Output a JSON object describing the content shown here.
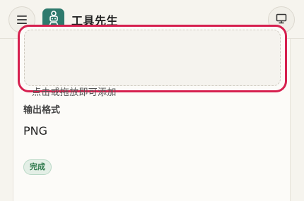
{
  "header": {
    "menu_icon": "hamburger-menu-icon",
    "logo_icon": "robot-logo-icon",
    "title": "工具先生",
    "monitor_icon": "monitor-icon"
  },
  "upload": {
    "hint": "点击或拖放即可添加",
    "accent_color": "#d6204f"
  },
  "output": {
    "label": "输出格式",
    "value": "PNG"
  },
  "status": {
    "badge": "完成",
    "color": "#2f7a4d"
  }
}
